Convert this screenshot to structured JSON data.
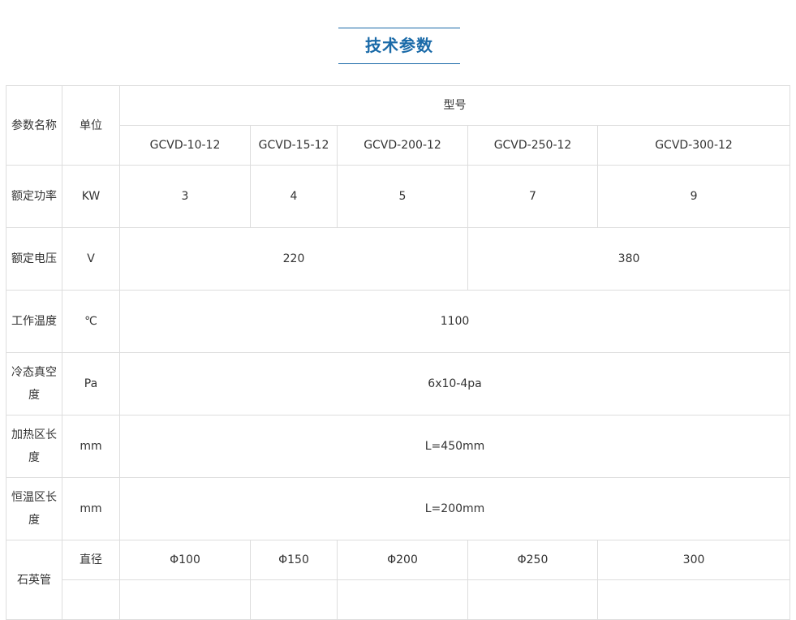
{
  "title": "技术参数",
  "header": {
    "param_name": "参数名称",
    "unit": "单位",
    "model": "型号",
    "models": [
      "GCVD-10-12",
      "GCVD-15-12",
      "GCVD-200-12",
      "GCVD-250-12",
      "GCVD-300-12"
    ]
  },
  "rows": {
    "power": {
      "name": "额定功率",
      "unit": "KW",
      "values": [
        "3",
        "4",
        "5",
        "7",
        "9"
      ]
    },
    "voltage": {
      "name": "额定电压",
      "unit": "V",
      "values": [
        "220",
        "380"
      ]
    },
    "temp": {
      "name": "工作温度",
      "unit": "℃",
      "value": "1100"
    },
    "vacuum": {
      "name": "冷态真空度",
      "unit": "Pa",
      "value": "6x10-4pa"
    },
    "heat_len": {
      "name": "加热区长度",
      "unit": "mm",
      "value": "L=450mm"
    },
    "const_len": {
      "name": "恒温区长度",
      "unit": "mm",
      "value": "L=200mm"
    },
    "tube": {
      "name": "石英管",
      "sub_label": "直径",
      "values": [
        "Φ100",
        "Φ150",
        "Φ200",
        "Φ250",
        "300"
      ]
    }
  }
}
